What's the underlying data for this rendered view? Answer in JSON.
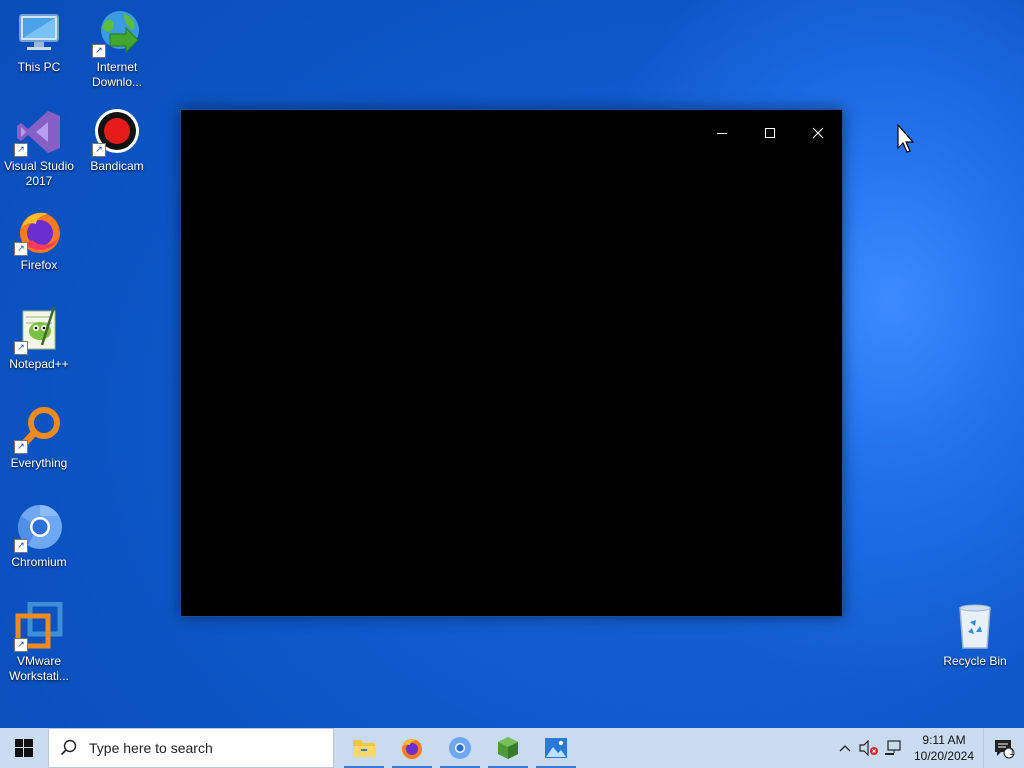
{
  "desktop": {
    "icons": [
      {
        "id": "this-pc",
        "label": "This PC"
      },
      {
        "id": "internet-download-manager",
        "label": "Internet Downlo..."
      },
      {
        "id": "visual-studio",
        "label": "Visual Studio 2017"
      },
      {
        "id": "bandicam",
        "label": "Bandicam"
      },
      {
        "id": "firefox",
        "label": "Firefox"
      },
      {
        "id": "notepad-plus-plus",
        "label": "Notepad++"
      },
      {
        "id": "everything",
        "label": "Everything"
      },
      {
        "id": "chromium",
        "label": "Chromium"
      },
      {
        "id": "vmware",
        "label": "VMware Workstati..."
      },
      {
        "id": "recycle-bin",
        "label": "Recycle Bin"
      }
    ]
  },
  "window": {
    "controls": [
      "minimize-icon",
      "maximize-icon",
      "close-icon"
    ]
  },
  "taskbar": {
    "search_placeholder": "Type here to search",
    "apps": [
      "file-explorer-icon",
      "firefox-icon",
      "chromium-icon",
      "cube-app-icon",
      "photos-icon"
    ],
    "clock_time": "9:11 AM",
    "clock_date": "10/20/2024",
    "notification_count": "1"
  },
  "colors": {
    "desktop_blue": "#0d57c9",
    "taskbar": "#c9dcef",
    "window_bg": "#000000"
  }
}
